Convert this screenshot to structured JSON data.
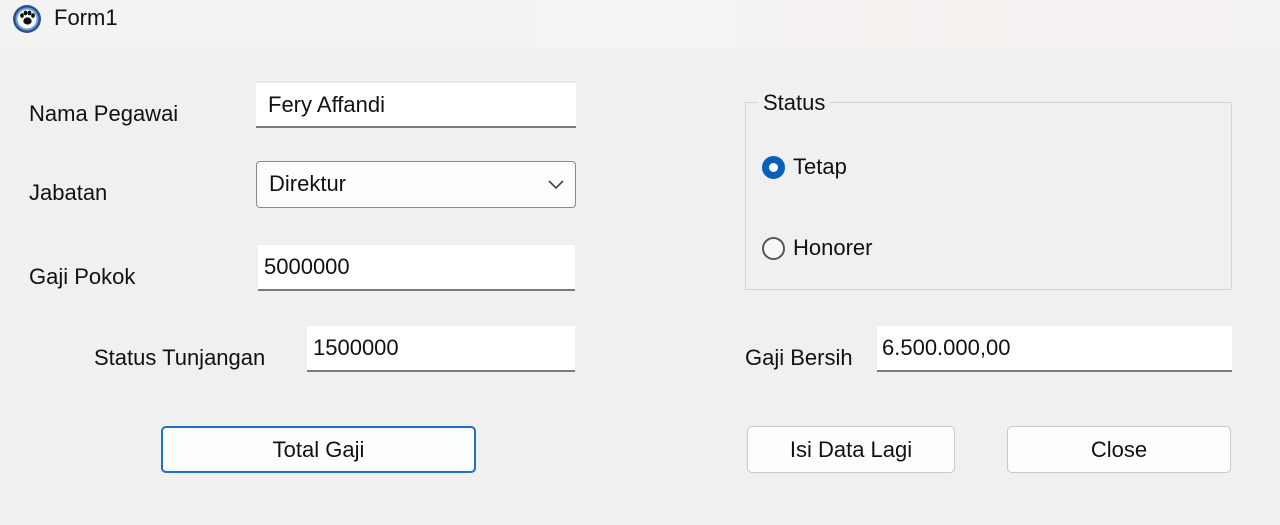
{
  "window": {
    "title": "Form1",
    "icon": "paw-icon"
  },
  "form": {
    "nama_pegawai": {
      "label": "Nama Pegawai",
      "value": "Fery Affandi"
    },
    "jabatan": {
      "label": "Jabatan",
      "selected": "Direktur"
    },
    "gaji_pokok": {
      "label": "Gaji Pokok",
      "value": "5000000"
    },
    "status_tunjangan": {
      "label": "Status Tunjangan",
      "value": "1500000"
    },
    "status": {
      "title": "Status",
      "options": [
        {
          "label": "Tetap",
          "checked": true
        },
        {
          "label": "Honorer",
          "checked": false
        }
      ]
    },
    "gaji_bersih": {
      "label": "Gaji Bersih",
      "value": "6.500.000,00"
    }
  },
  "buttons": {
    "total_gaji": "Total Gaji",
    "isi_data_lagi": "Isi Data Lagi",
    "close": "Close"
  },
  "colors": {
    "accent": "#0a5fb8",
    "background": "#f0f0f0"
  }
}
